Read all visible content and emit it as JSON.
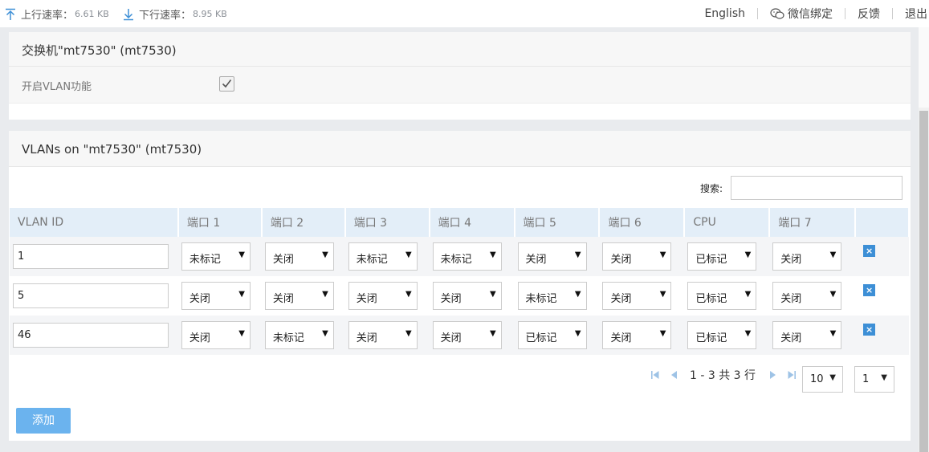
{
  "topbar": {
    "upload_label": "上行速率：",
    "upload_value": "6.61 KB",
    "download_label": "下行速率：",
    "download_value": "8.95 KB",
    "links": {
      "language": "English",
      "wechat": "微信绑定",
      "feedback": "反馈",
      "logout": "退出"
    }
  },
  "switch_panel": {
    "title": "交换机\"mt7530\" (mt7530)",
    "vlan_enable_label": "开启VLAN功能",
    "vlan_enabled": true
  },
  "vlan_panel": {
    "title": "VLANs on \"mt7530\" (mt7530)",
    "search_label": "搜索:",
    "search_value": "",
    "columns": [
      "VLAN ID",
      "端口 1",
      "端口 2",
      "端口 3",
      "端口 4",
      "端口 5",
      "端口 6",
      "CPU",
      "端口 7"
    ],
    "rows": [
      {
        "id": "1",
        "ports": [
          "未标记",
          "关闭",
          "未标记",
          "未标记",
          "关闭",
          "关闭",
          "已标记",
          "关闭"
        ]
      },
      {
        "id": "5",
        "ports": [
          "关闭",
          "关闭",
          "关闭",
          "关闭",
          "未标记",
          "关闭",
          "已标记",
          "关闭"
        ]
      },
      {
        "id": "46",
        "ports": [
          "关闭",
          "未标记",
          "关闭",
          "关闭",
          "已标记",
          "关闭",
          "已标记",
          "关闭"
        ]
      }
    ],
    "pagination": {
      "summary": "1 - 3 共 3 行",
      "page_size": "10",
      "page": "1"
    },
    "add_button": "添加"
  },
  "colors": {
    "accent": "#3d8fd6",
    "header_bg": "#e3eef8",
    "add_button": "#6bb3ee"
  }
}
